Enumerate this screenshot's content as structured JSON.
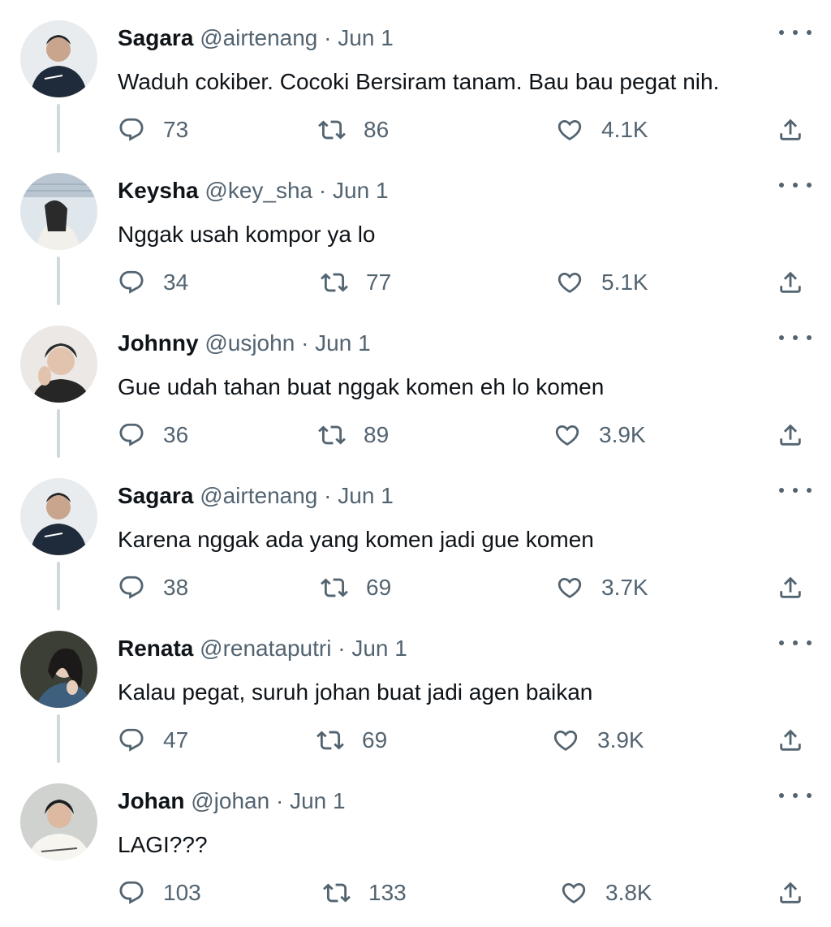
{
  "colors": {
    "text": "#0f1419",
    "secondary": "#536471",
    "thread_line": "#cfd9de"
  },
  "icons": {
    "reply": "reply-icon",
    "retweet": "retweet-icon",
    "like": "heart-icon",
    "share": "share-icon",
    "more": "more-icon"
  },
  "tweets": [
    {
      "name": "Sagara",
      "handle": "@airtenang",
      "sep": "·",
      "date": "Jun 1",
      "text": "Waduh cokiber. Cocoki Bersiram tanam. Bau bau pegat nih.",
      "replies": "73",
      "retweets": "86",
      "likes": "4.1K"
    },
    {
      "name": "Keysha",
      "handle": "@key_sha",
      "sep": "·",
      "date": "Jun 1",
      "text": "Nggak usah kompor ya lo",
      "replies": "34",
      "retweets": "77",
      "likes": "5.1K"
    },
    {
      "name": "Johnny",
      "handle": "@usjohn",
      "sep": "·",
      "date": "Jun 1",
      "text": "Gue udah tahan buat nggak komen eh lo komen",
      "replies": "36",
      "retweets": "89",
      "likes": "3.9K"
    },
    {
      "name": "Sagara",
      "handle": "@airtenang",
      "sep": "·",
      "date": "Jun 1",
      "text": "Karena nggak ada yang komen jadi gue komen",
      "replies": "38",
      "retweets": "69",
      "likes": "3.7K"
    },
    {
      "name": "Renata",
      "handle": "@renataputri",
      "sep": "·",
      "date": "Jun 1",
      "text": "Kalau pegat, suruh johan buat jadi agen baikan",
      "replies": "47",
      "retweets": "69",
      "likes": "3.9K"
    },
    {
      "name": "Johan",
      "handle": "@johan",
      "sep": "·",
      "date": "Jun 1",
      "text": "LAGI???",
      "replies": "103",
      "retweets": "133",
      "likes": "3.8K"
    }
  ]
}
